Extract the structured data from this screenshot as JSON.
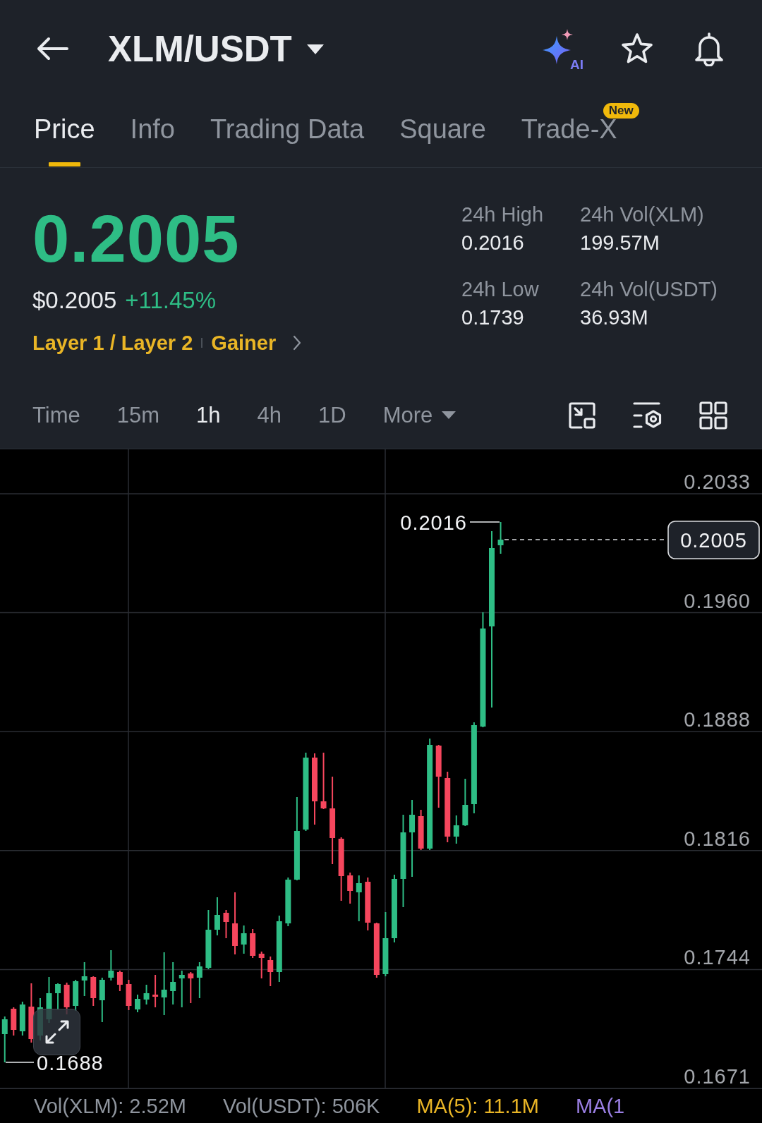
{
  "header": {
    "title": "XLM/USDT",
    "ai_label": "AI"
  },
  "tabs": [
    {
      "label": "Price",
      "selected": true
    },
    {
      "label": "Info",
      "selected": false
    },
    {
      "label": "Trading Data",
      "selected": false
    },
    {
      "label": "Square",
      "selected": false
    },
    {
      "label": "Trade-X",
      "selected": false,
      "badge": "New"
    }
  ],
  "ticker": {
    "last_price": "0.2005",
    "usd_price": "$0.2005",
    "change": "+11.45%",
    "tags": [
      "Layer 1 / Layer 2",
      "Gainer"
    ]
  },
  "stats": [
    {
      "label": "24h High",
      "value": "0.2016"
    },
    {
      "label": "24h Vol(XLM)",
      "value": "199.57M"
    },
    {
      "label": "24h Low",
      "value": "0.1739"
    },
    {
      "label": "24h Vol(USDT)",
      "value": "36.93M"
    }
  ],
  "intervals": [
    {
      "label": "Time",
      "selected": false,
      "kind": "option"
    },
    {
      "label": "15m",
      "selected": false,
      "kind": "option"
    },
    {
      "label": "1h",
      "selected": true,
      "kind": "option"
    },
    {
      "label": "4h",
      "selected": false,
      "kind": "option"
    },
    {
      "label": "1D",
      "selected": false,
      "kind": "option"
    },
    {
      "label": "More",
      "selected": false,
      "kind": "dropdown"
    }
  ],
  "chart": {
    "price_axis": [
      "0.2033",
      "0.1960",
      "0.1888",
      "0.1816",
      "0.1744",
      "0.1671"
    ],
    "high_label": "0.2016",
    "low_label": "0.1688",
    "last_price_label": "0.2005"
  },
  "volume_bar": [
    {
      "text": "Vol(XLM): 2.52M",
      "color": "#8f959e"
    },
    {
      "text": "Vol(USDT): 506K",
      "color": "#8f959e"
    },
    {
      "text": "MA(5): 11.1M",
      "color": "#e9b526"
    },
    {
      "text": "MA(1",
      "color": "#9a7fe3"
    }
  ]
}
